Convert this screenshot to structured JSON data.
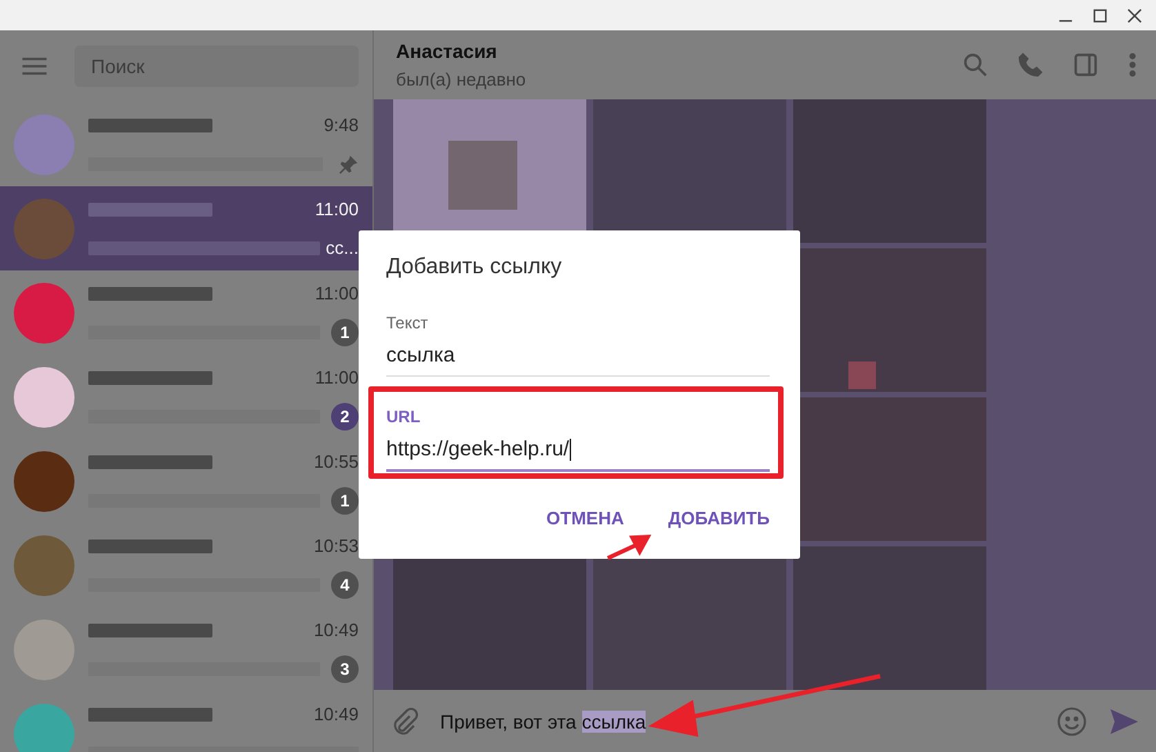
{
  "sidebar": {
    "search": {
      "placeholder": "Поиск"
    },
    "chats": [
      {
        "time": "9:48",
        "pinned": true,
        "selected": false,
        "color": "#8a7fb0"
      },
      {
        "time": "11:00",
        "pinned": false,
        "selected": true,
        "preview_tail": "сс...",
        "color": "#6b4c3a"
      },
      {
        "time": "11:00",
        "pinned": false,
        "selected": false,
        "unread": "1",
        "muted": true,
        "color": "#d81b45"
      },
      {
        "time": "11:00",
        "pinned": false,
        "selected": false,
        "unread": "2",
        "muted": false,
        "color": "#e6c8d8"
      },
      {
        "time": "10:55",
        "pinned": false,
        "selected": false,
        "unread": "1",
        "muted": true,
        "color": "#5a2c12"
      },
      {
        "time": "10:53",
        "pinned": false,
        "selected": false,
        "unread": "4",
        "muted": true,
        "color": "#6e5a3a"
      },
      {
        "time": "10:49",
        "pinned": false,
        "selected": false,
        "unread": "3",
        "muted": true,
        "color": "#a09a94"
      },
      {
        "time": "10:49",
        "pinned": false,
        "selected": false,
        "color": "#3aa6a0"
      }
    ]
  },
  "chat": {
    "name": "Анастасия",
    "status": "был(а) недавно",
    "composer": {
      "value": "Привет, вот эта ",
      "selection": "ссылка"
    }
  },
  "dialog": {
    "title": "Добавить ссылку",
    "fields": [
      {
        "label": "Текст",
        "value": "ссылка",
        "focused": false
      },
      {
        "label": "URL",
        "value": "https://geek-help.ru/",
        "focused": true
      }
    ],
    "buttons": [
      "ОТМЕНА",
      "ДОБАВИТЬ"
    ]
  }
}
